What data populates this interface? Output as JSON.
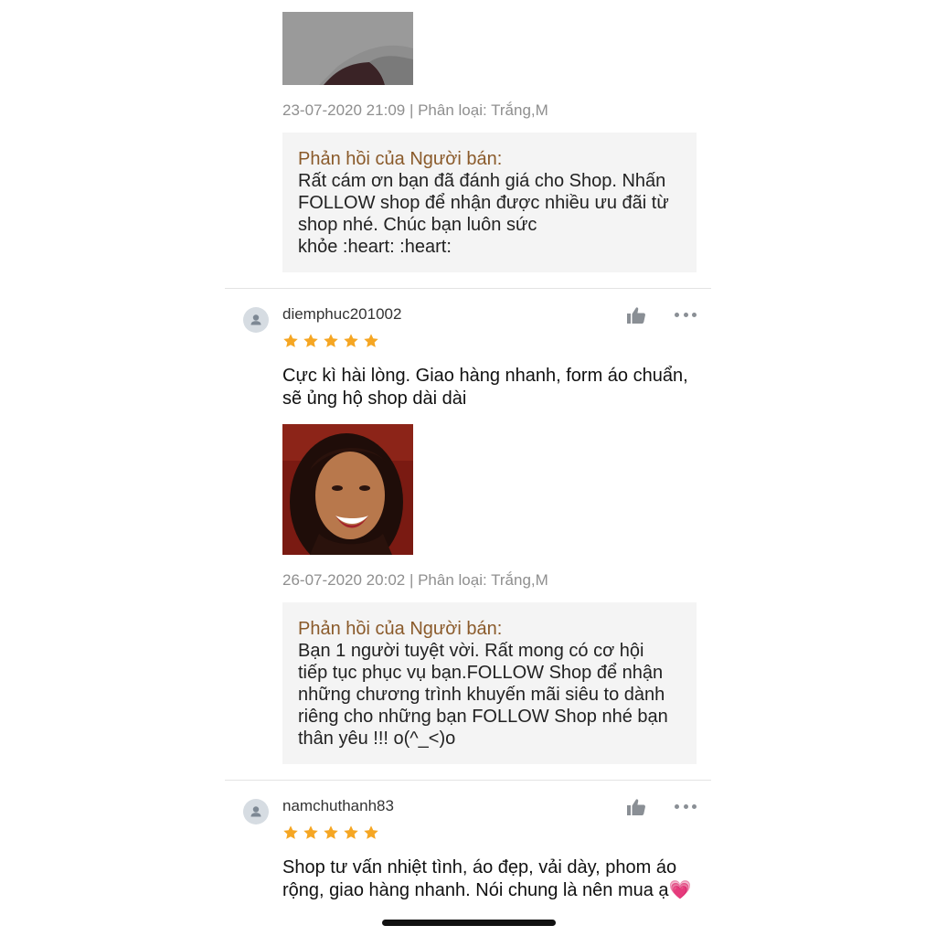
{
  "reviews": [
    {
      "timestamp": "23-07-2020 21:09 | Phân loại: Trắng,M",
      "reply_title": "Phản hồi của Người bán:",
      "reply_body": " Rất cám ơn bạn đã đánh giá cho Shop. Nhấn\nFOLLOW shop để nhận được nhiều ưu đãi từ\nshop nhé. Chúc bạn luôn sức\nkhỏe :heart: :heart:"
    },
    {
      "username": "diemphuc201002",
      "rating": 5,
      "comment": "Cực kì hài lòng. Giao hàng nhanh, form áo chuẩn, sẽ ủng hộ shop dài dài",
      "timestamp": "26-07-2020 20:02 | Phân loại: Trắng,M",
      "reply_title": "Phản hồi của Người bán:",
      "reply_body": "Bạn 1 người tuyệt vời. Rất mong có cơ hội\ntiếp tục phục vụ bạn.FOLLOW Shop để nhận\nnhững chương trình khuyến mãi siêu to dành\nriêng cho những bạn FOLLOW Shop nhé bạn\nthân yêu !!! o(^_<)o"
    },
    {
      "username": "namchuthanh83",
      "rating": 5,
      "comment": "Shop tư vấn nhiệt tình, áo đẹp, vải dày, phom áo rộng, giao hàng nhanh. Nói chung là nên mua ạ💗"
    }
  ],
  "icons": {
    "avatar": "user-avatar-icon",
    "like": "thumbs-up-icon",
    "more": "more-options-icon",
    "star": "star-icon"
  },
  "colors": {
    "star": "#f5a623",
    "reply_title": "#8a5a2a",
    "meta_text": "#8f8f8f",
    "reply_bg": "#f4f4f4"
  }
}
